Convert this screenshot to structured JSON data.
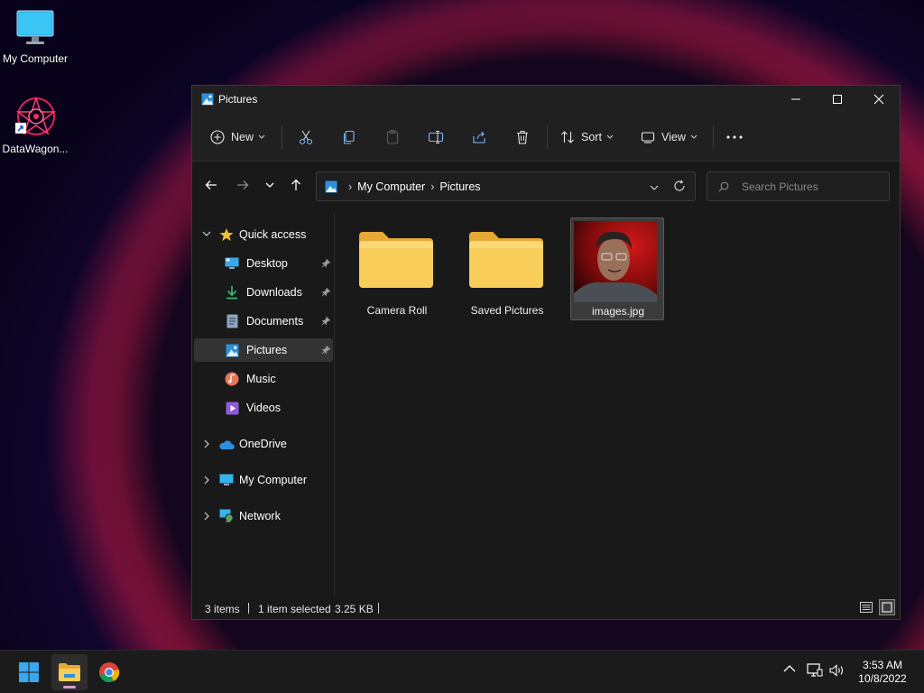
{
  "desktop": {
    "icons": [
      {
        "label": "My Computer"
      },
      {
        "label": "DataWagon..."
      }
    ]
  },
  "window": {
    "title": "Pictures",
    "toolbar": {
      "new_label": "New",
      "sort_label": "Sort",
      "view_label": "View"
    },
    "address": {
      "crumbs": [
        "My Computer",
        "Pictures"
      ]
    },
    "search": {
      "placeholder": "Search Pictures"
    },
    "nav": {
      "quick_access": "Quick access",
      "items": [
        {
          "label": "Desktop",
          "pinned": true
        },
        {
          "label": "Downloads",
          "pinned": true
        },
        {
          "label": "Documents",
          "pinned": true
        },
        {
          "label": "Pictures",
          "pinned": true,
          "selected": true
        },
        {
          "label": "Music",
          "pinned": false
        },
        {
          "label": "Videos",
          "pinned": false
        }
      ],
      "roots": [
        {
          "label": "OneDrive"
        },
        {
          "label": "My Computer"
        },
        {
          "label": "Network"
        }
      ]
    },
    "files": [
      {
        "name": "Camera Roll",
        "type": "folder"
      },
      {
        "name": "Saved Pictures",
        "type": "folder"
      },
      {
        "name": "images.jpg",
        "type": "image",
        "selected": true
      }
    ],
    "status": {
      "count": "3 items",
      "selection": "1 item selected",
      "size": "3.25 KB"
    }
  },
  "taskbar": {
    "apps": [
      "start-icon",
      "file-explorer-icon",
      "chrome-icon"
    ],
    "time": "3:53 AM",
    "date": "10/8/2022"
  },
  "colors": {
    "accent": "#4cc2ff",
    "folder": "#f8cd5a",
    "window_bg": "#191919"
  }
}
